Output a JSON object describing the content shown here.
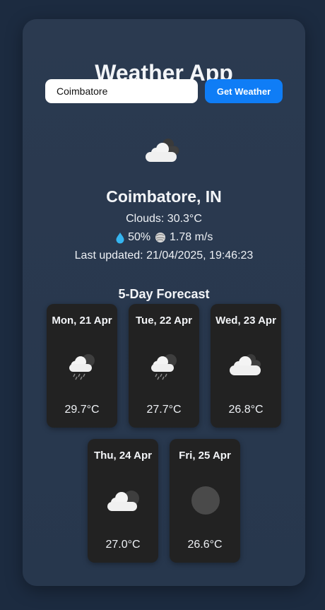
{
  "app": {
    "title": "Weather App"
  },
  "search": {
    "value": "Coimbatore",
    "button_label": "Get Weather"
  },
  "current": {
    "icon": "cloud-icon",
    "location": "Coimbatore, IN",
    "condition": "Clouds: 30.3°C",
    "humidity": "50%",
    "wind": "1.78 m/s",
    "last_updated": "Last updated: 21/04/2025, 19:46:23"
  },
  "forecast": {
    "title": "5-Day Forecast",
    "days": [
      {
        "date": "Mon, 21 Apr",
        "temp": "29.7°C",
        "icon": "rain-cloud-icon"
      },
      {
        "date": "Tue, 22 Apr",
        "temp": "27.7°C",
        "icon": "rain-cloud-icon"
      },
      {
        "date": "Wed, 23 Apr",
        "temp": "26.8°C",
        "icon": "cloud-icon"
      },
      {
        "date": "Thu, 24 Apr",
        "temp": "27.0°C",
        "icon": "cloud-icon"
      },
      {
        "date": "Fri, 25 Apr",
        "temp": "26.6°C",
        "icon": "overcast-icon"
      }
    ]
  },
  "colors": {
    "background": "#1c2b40",
    "card": "#2b3a50",
    "accent": "#0f7df6",
    "forecast_card": "#222222"
  }
}
